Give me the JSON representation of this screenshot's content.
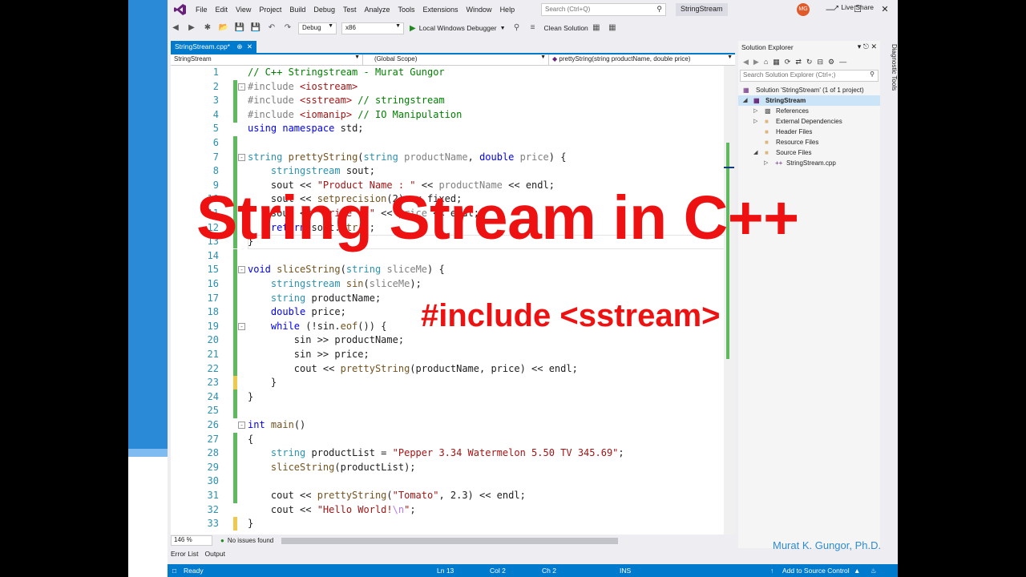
{
  "menu": [
    "File",
    "Edit",
    "View",
    "Project",
    "Build",
    "Debug",
    "Test",
    "Analyze",
    "Tools",
    "Extensions",
    "Window",
    "Help"
  ],
  "search": {
    "placeholder": "Search (Ctrl+Q)"
  },
  "solution_name": "StringStream",
  "avatar": "MG",
  "toolbar": {
    "config": "Debug",
    "platform": "x86",
    "run_label": "Local Windows Debugger",
    "clean_label": "Clean Solution",
    "live_share": "Live Share"
  },
  "doc_tab": "StringStream.cpp*",
  "nav": {
    "project": "StringStream",
    "scope": "(Global Scope)",
    "member": "prettyString(string productName, double price)"
  },
  "code_lines": [
    "1",
    "2",
    "3",
    "4",
    "5",
    "6",
    "7",
    "8",
    "9",
    "10",
    "11",
    "12",
    "13",
    "14",
    "15",
    "16",
    "17",
    "18",
    "19",
    "20",
    "21",
    "22",
    "23",
    "24",
    "25",
    "26",
    "27",
    "28",
    "29",
    "30",
    "31",
    "32",
    "33"
  ],
  "editor_status": {
    "zoom": "146 %",
    "issues": "No issues found"
  },
  "bottom_tabs": [
    "Error List",
    "Output"
  ],
  "status": {
    "ready": "Ready",
    "ln": "Ln 13",
    "col": "Col 2",
    "ch": "Ch 2",
    "ins": "INS",
    "source_control": "Add to Source Control"
  },
  "solution_explorer": {
    "title": "Solution Explorer",
    "search_placeholder": "Search Solution Explorer (Ctrl+;)",
    "items": [
      {
        "label": "Solution 'StringStream' (1 of 1 project)"
      },
      {
        "label": "StringStream"
      },
      {
        "label": "References"
      },
      {
        "label": "External Dependencies"
      },
      {
        "label": "Header Files"
      },
      {
        "label": "Resource Files"
      },
      {
        "label": "Source Files"
      },
      {
        "label": "StringStream.cpp"
      }
    ]
  },
  "diagnostic_tools": "Diagnostic Tools",
  "overlay": {
    "title": "String Stream in C++",
    "subtitle": "#include <sstream>",
    "author": "Murat K. Gungor, Ph.D."
  }
}
